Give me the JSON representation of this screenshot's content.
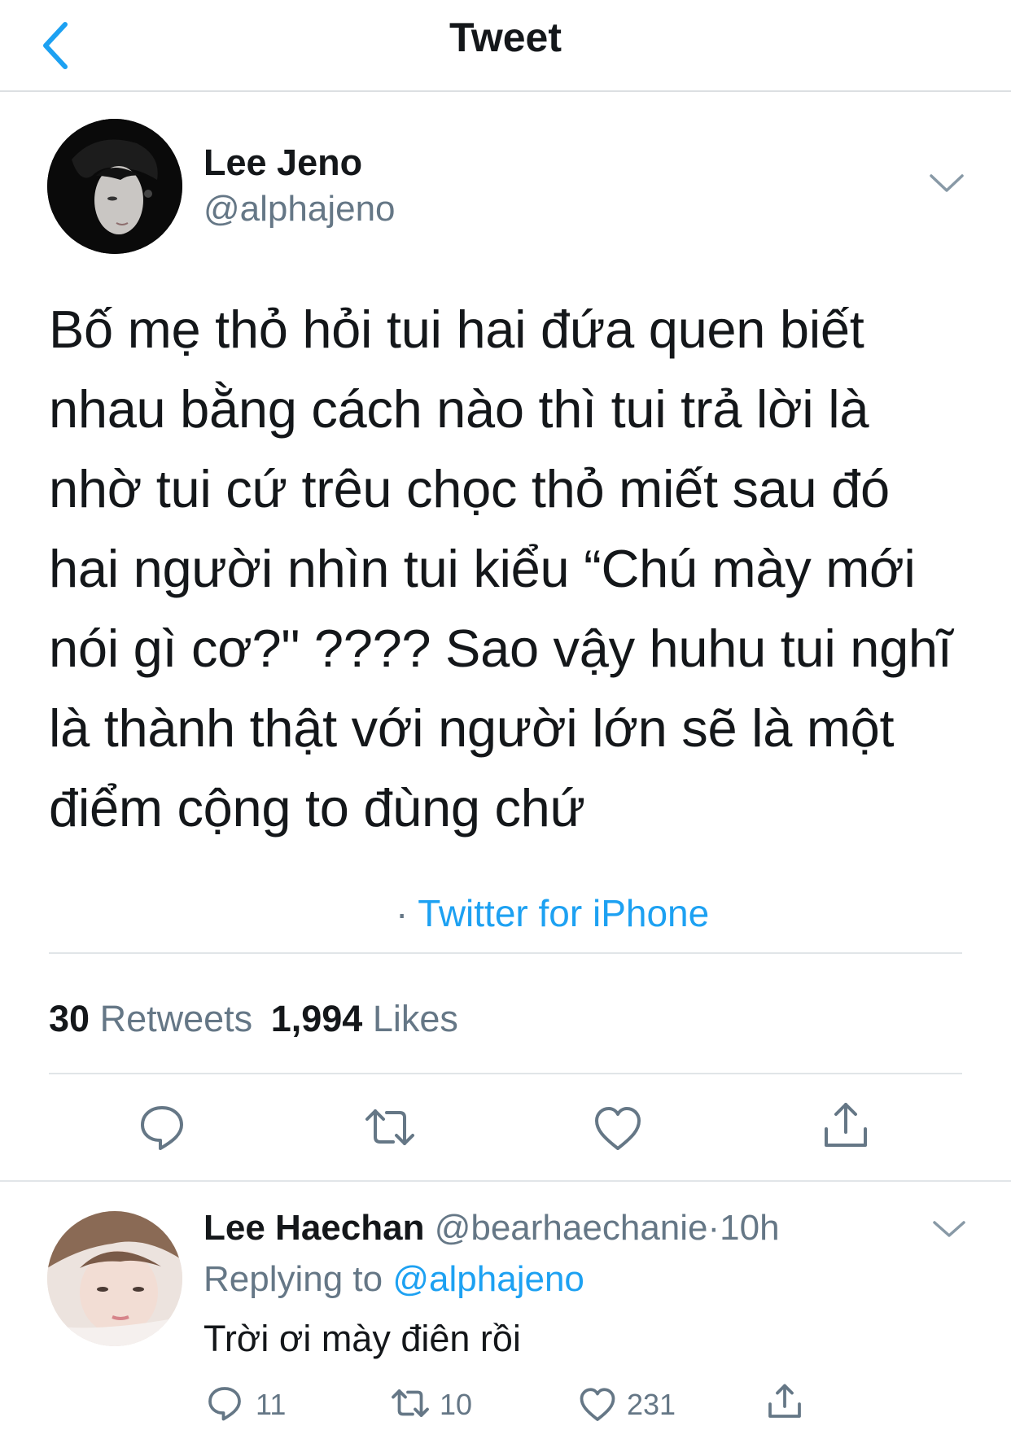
{
  "header": {
    "title": "Tweet"
  },
  "tweet": {
    "author_name": "Lee Jeno",
    "author_handle": "@alphajeno",
    "text_lines": [
      "Bố mẹ thỏ hỏi tui hai đứa quen biết",
      "nhau bằng cách nào thì tui trả lời là",
      "nhờ tui cứ trêu chọc thỏ miết sau đó",
      "hai người nhìn tui kiểu “Chú mày mới",
      "nói gì cơ?\" ???? Sao vậy huhu tui nghĩ",
      "là thành thật với người lớn sẽ là một",
      "điểm cộng to đùng chứ"
    ],
    "source_prefix": "·",
    "source": "Twitter for iPhone",
    "retweets_count": "30",
    "retweets_label": "Retweets",
    "likes_count": "1,994",
    "likes_label": "Likes"
  },
  "reply": {
    "author_name": "Lee Haechan",
    "author_handle": "@bearhaechanie",
    "separator": "·",
    "time": "10h",
    "replying_prefix": "Replying to",
    "replying_to": "@alphajeno",
    "text": "Trời ơi mày điên rồi",
    "reply_count": "11",
    "retweet_count": "10",
    "like_count": "231"
  },
  "colors": {
    "accent": "#1da1f2",
    "text_primary": "#14171a",
    "text_secondary": "#657786",
    "divider": "#e1e5e8"
  },
  "icons": [
    "back-chevron-icon",
    "chevron-down-icon",
    "reply-icon",
    "retweet-icon",
    "like-icon",
    "share-icon"
  ]
}
